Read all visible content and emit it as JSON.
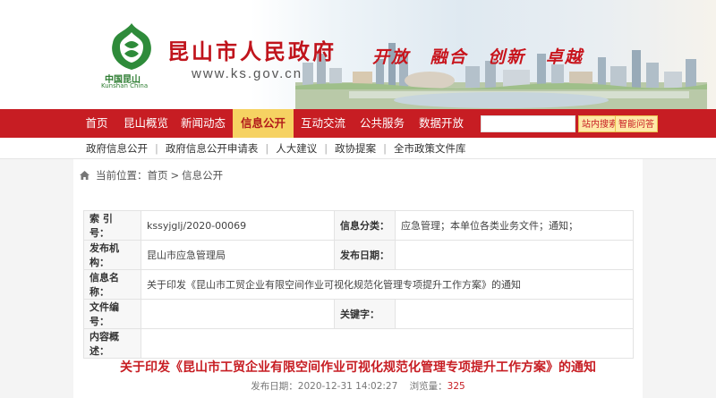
{
  "banner": {
    "title": "昆山市人民政府",
    "url": "www.ks.gov.cn",
    "logo_caption": "中国昆山",
    "logo_caption_en": "Kunshan China",
    "slogan": [
      "开放",
      "融合",
      "创新",
      "卓越"
    ]
  },
  "nav": {
    "items": [
      "首页",
      "昆山概览",
      "新闻动态",
      "信息公开",
      "互动交流",
      "公共服务",
      "数据开放"
    ],
    "active": "信息公开",
    "search_placeholder": "",
    "search_button": "站内搜索",
    "smart_button": "智能问答"
  },
  "subnav": {
    "items": [
      "政府信息公开",
      "政府信息公开申请表",
      "人大建议",
      "政协提案",
      "全市政策文件库"
    ]
  },
  "breadcrumb": {
    "prefix": "当前位置：",
    "home": "首页",
    "sep": ">",
    "current": "信息公开"
  },
  "info": {
    "index_label": "索 引 号：",
    "index_value": "kssyjglj/2020-00069",
    "category_label": "信息分类：",
    "category_value": "应急管理；本单位各类业务文件；通知；",
    "publisher_label": "发布机构：",
    "publisher_value": "昆山市应急管理局",
    "date_label": "发布日期：",
    "date_value": "",
    "name_label": "信息名称：",
    "name_value": "关于印发《昆山市工贸企业有限空间作业可视化规范化管理专项提升工作方案》的通知",
    "docnum_label": "文件编号：",
    "docnum_value": "",
    "keywords_label": "关键字：",
    "keywords_value": "",
    "summary_label": "内容概述：",
    "summary_value": ""
  },
  "document": {
    "title": "关于印发《昆山市工贸企业有限空间作业可视化规范化管理专项提升工作方案》的通知",
    "date_label": "发布日期：",
    "date_value": "2020-12-31 14:02:27",
    "views_label": "浏览量：",
    "views_value": "325"
  },
  "colors": {
    "brand_red": "#c71d23",
    "active_tab": "#f6d262",
    "logo_green": "#2e7d32"
  }
}
